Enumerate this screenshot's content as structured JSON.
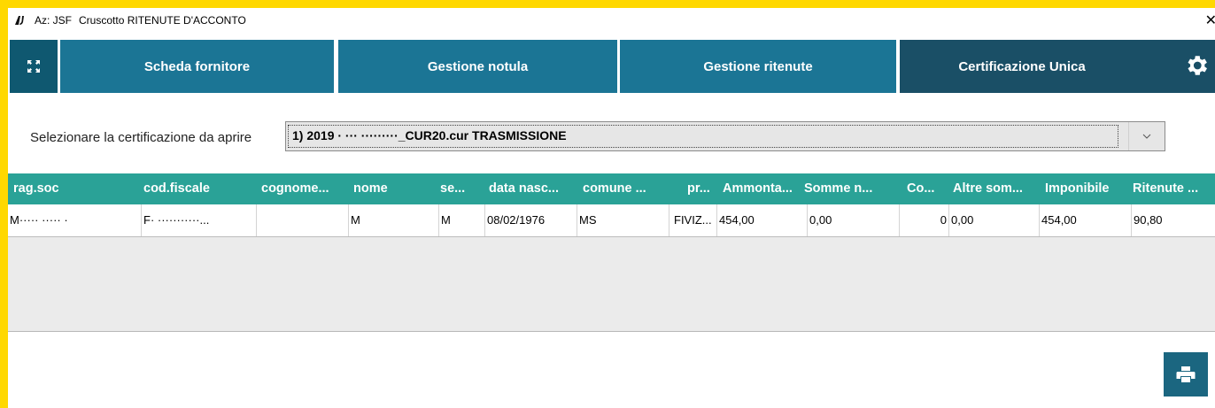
{
  "window": {
    "app_name": "Az: JSF",
    "title": "Cruscotto RITENUTE D'ACCONTO",
    "close_glyph": "✕"
  },
  "nav": {
    "tabs": [
      {
        "label": "Scheda fornitore",
        "active": false
      },
      {
        "label": "Gestione notula",
        "active": false
      },
      {
        "label": "Gestione ritenute",
        "active": false
      },
      {
        "label": "Certificazione Unica",
        "active": true
      }
    ]
  },
  "selector": {
    "label": "Selezionare la certificazione da aprire",
    "value": "1) 2019 · ··· ·········_CUR20.cur  TRASMISSIONE"
  },
  "grid": {
    "columns": [
      "rag.soc",
      "cod.fiscale",
      "cognome...",
      "nome",
      "se...",
      "data nasc...",
      "comune ...",
      "pr...",
      "Ammonta...",
      "Somme n...",
      "Co...",
      "Altre som...",
      "Imponibile",
      "Ritenute ..."
    ],
    "rows": [
      [
        "M····· ····· ·",
        "F· ···········...",
        "",
        "M",
        "M",
        "08/02/1976",
        "MS",
        "FIVIZ...",
        "454,00",
        "0,00",
        "0",
        "0,00",
        "454,00",
        "90,80"
      ]
    ]
  },
  "colors": {
    "tab": "#1b7595",
    "tab_active": "#1a4f66",
    "grid_header": "#2aa297",
    "frame": "#ffd800"
  }
}
